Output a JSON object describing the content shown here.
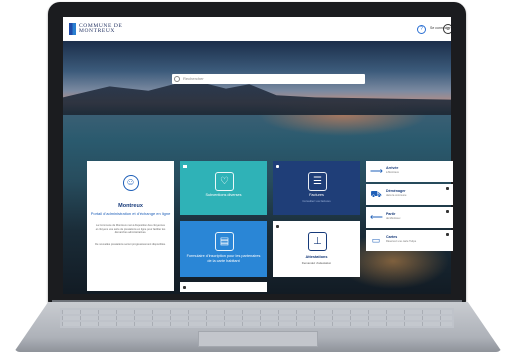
{
  "header": {
    "logo_line1": "COMMUNE DE",
    "logo_line2": "MONTREUX",
    "login_label": "Se connecter"
  },
  "search": {
    "placeholder": "Rechercher"
  },
  "welcome": {
    "title": "Montreux",
    "subtitle": "Portail d’administration et d’échange en ligne",
    "body1": "La Commune de Montreux met à disposition des citoyennes et citoyens une série de prestations en ligne pour faciliter les démarches administratives.",
    "body2": "De nouvelles prestations seront progressivement disponibles."
  },
  "tiles": [
    {
      "label": "Subventions diverses",
      "sublabel": ""
    },
    {
      "label": "Formulaire d’inscription pour les partenaires de la carte habitant",
      "sublabel": ""
    },
    {
      "label": "Factures",
      "sublabel": "Consultez vos factures"
    },
    {
      "label": "Attestations",
      "sublabel": "Demandez d’attestation"
    }
  ],
  "side_items": [
    {
      "title": "Arrivée",
      "sub": "à Montreux",
      "icon": "arrow-right-icon"
    },
    {
      "title": "Déménager",
      "sub": "dans la commune",
      "icon": "truck-icon"
    },
    {
      "title": "Partir",
      "sub": "de Montreux",
      "icon": "arrow-left-icon"
    },
    {
      "title": "Cartes",
      "sub": "Réservez une carte Tulipe",
      "icon": "cards-icon"
    }
  ],
  "colors": {
    "teal": "#2fb2b7",
    "blue": "#2a86d6",
    "navy": "#1f3e78",
    "brand": "#163a7a"
  }
}
